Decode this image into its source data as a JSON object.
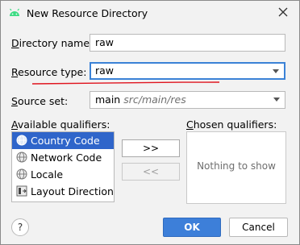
{
  "window": {
    "title": "New Resource Directory"
  },
  "form": {
    "directory_name_label": "Directory name:",
    "directory_name_value": "raw",
    "resource_type_label": "Resource type:",
    "resource_type_value": "raw",
    "source_set_label": "Source set:",
    "source_set_value": "main",
    "source_set_path": "src/main/res"
  },
  "qualifiers": {
    "available_label": "Available qualifiers:",
    "chosen_label": "Chosen qualifiers:",
    "chosen_empty": "Nothing to show",
    "available": [
      {
        "label": "Country Code",
        "icon": "globe-icon",
        "selected": true
      },
      {
        "label": "Network Code",
        "icon": "network-icon",
        "selected": false
      },
      {
        "label": "Locale",
        "icon": "globe-icon",
        "selected": false
      },
      {
        "label": "Layout Direction",
        "icon": "layout-direction-icon",
        "selected": false
      }
    ],
    "add_label": ">>",
    "remove_label": "<<"
  },
  "footer": {
    "help_label": "?",
    "ok_label": "OK",
    "cancel_label": "Cancel"
  },
  "colors": {
    "accent": "#3d7fd9",
    "selection": "#2f65ca",
    "annotation": "#e0141e",
    "android": "#3ddc84"
  }
}
